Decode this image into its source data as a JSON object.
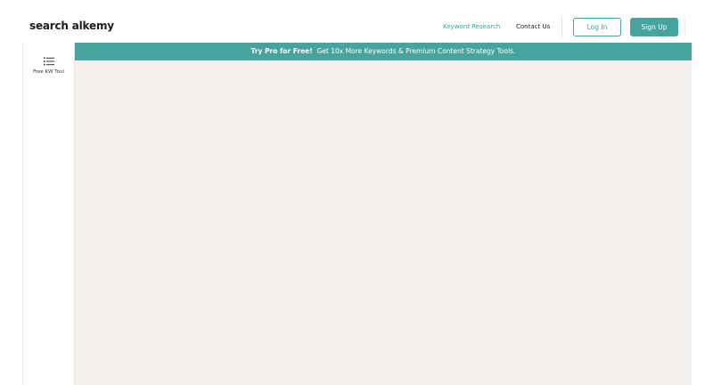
{
  "header": {
    "logo": "search alkemy",
    "nav": {
      "keyword_research": "Keyword Research",
      "contact_us": "Contact Us"
    },
    "login_label": "Log In",
    "signup_label": "Sign Up"
  },
  "sidebar": {
    "items": [
      {
        "label": "Free KW Tool",
        "icon": "list-icon"
      }
    ]
  },
  "promo": {
    "highlight": "Try Pro for Free!",
    "text": "Get 10x More Keywords & Premium Content Strategy Tools."
  },
  "colors": {
    "accent": "#47a39e",
    "content_bg": "#f2efed"
  }
}
